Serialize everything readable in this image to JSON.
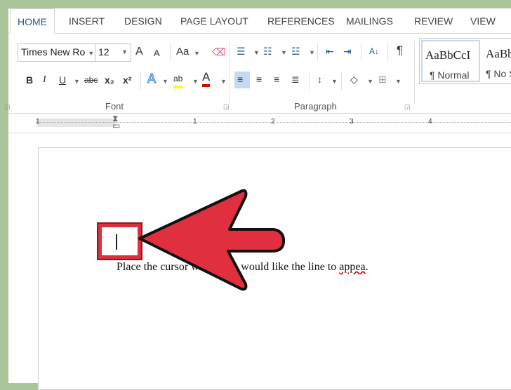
{
  "tabs": [
    "HOME",
    "INSERT",
    "DESIGN",
    "PAGE LAYOUT",
    "REFERENCES",
    "MAILINGS",
    "REVIEW",
    "VIEW"
  ],
  "font": {
    "name": "Times New Ro",
    "size": "12",
    "group_label": "Font",
    "change_case": "Aa",
    "bold": "B",
    "italic": "I",
    "underline": "U",
    "strike": "abc",
    "subscript": "x₂",
    "superscript": "x²",
    "grow": "A",
    "shrink": "A",
    "text_effects": "A",
    "highlight": "ab",
    "font_color": "A"
  },
  "paragraph": {
    "group_label": "Paragraph",
    "sort": "A↓",
    "pilcrow": "¶"
  },
  "styles": [
    {
      "sample": "AaBbCcI",
      "name": "¶ Normal"
    },
    {
      "sample": "AaBb",
      "name": "¶ No S"
    }
  ],
  "ruler": {
    "labels": [
      "1",
      "1",
      "2",
      "3",
      "4"
    ]
  },
  "document": {
    "text": "Place the cursor where you would like the line to ",
    "misspelled": "appea",
    "end": "."
  },
  "colors": {
    "accent": "#2b579a",
    "arrow": "#e03040",
    "highlight": "#ffff00",
    "font_color": "#e00000"
  }
}
